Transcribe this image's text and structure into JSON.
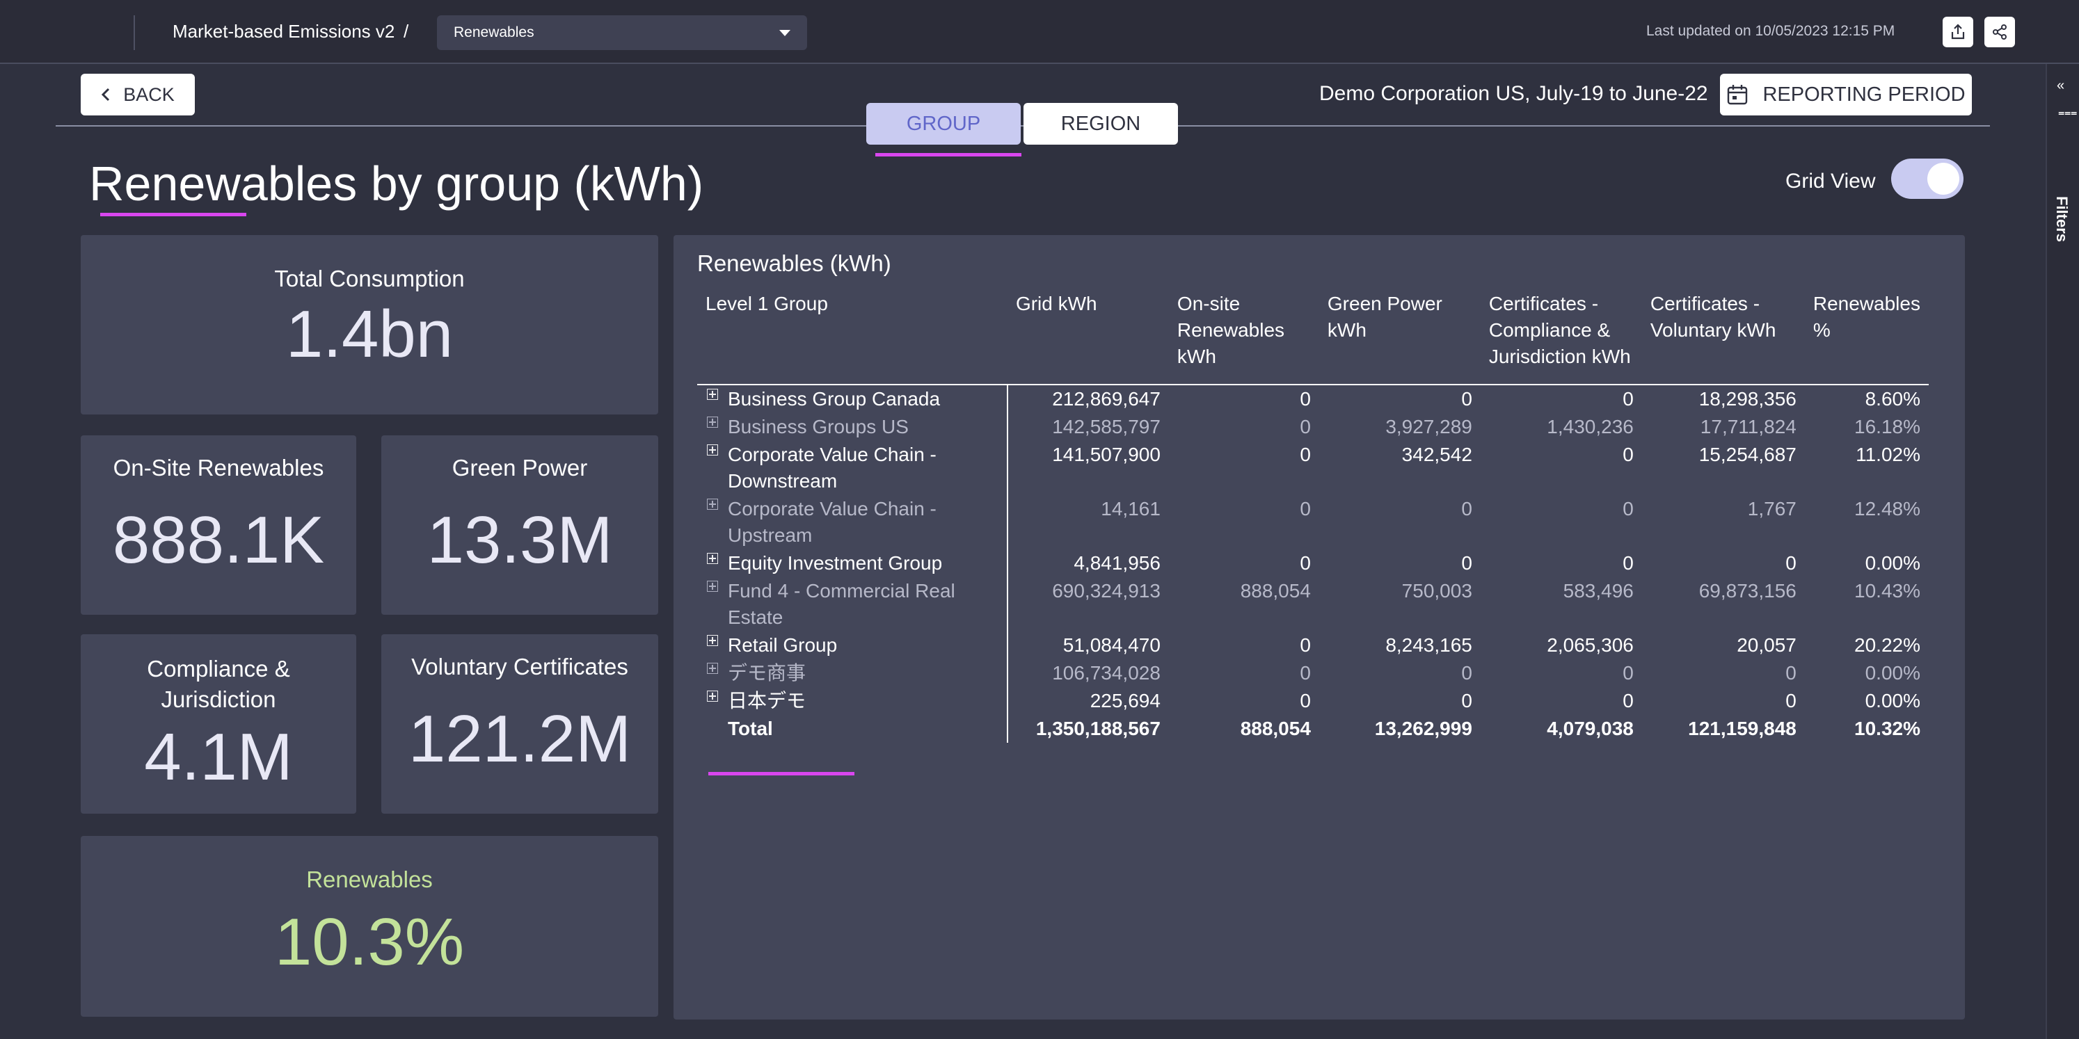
{
  "header": {
    "breadcrumb_title": "Market-based Emissions v2",
    "breadcrumb_sep": "/",
    "report_select": "Renewables",
    "last_updated": "Last updated on 10/05/2023 12:15 PM"
  },
  "nav": {
    "back_label": "BACK",
    "tabs": [
      {
        "label": "GROUP",
        "active": true
      },
      {
        "label": "REGION",
        "active": false
      }
    ],
    "company_period": "Demo Corporation US, July-19 to June-22",
    "reporting_period_label": "REPORTING PERIOD"
  },
  "filters_rail": {
    "label": "Filters"
  },
  "page": {
    "title": "Renewables by group (kWh)",
    "grid_view_label": "Grid View",
    "grid_view_on": true
  },
  "kpis": {
    "total": {
      "label": "Total Consumption",
      "value": "1.4bn"
    },
    "onsite": {
      "label": "On-Site Renewables",
      "value": "888.1K"
    },
    "green": {
      "label": "Green Power",
      "value": "13.3M"
    },
    "compliance": {
      "label": "Compliance & Jurisdiction",
      "value": "4.1M"
    },
    "voluntary": {
      "label": "Voluntary Certificates",
      "value": "121.2M"
    },
    "renewables": {
      "label": "Renewables",
      "value": "10.3%",
      "accent": "#c3e29a"
    }
  },
  "table": {
    "title": "Renewables (kWh)",
    "headers": [
      "Level 1 Group",
      "Grid kWh",
      "On-site Renewables kWh",
      "Green Power kWh",
      "Certificates - Compliance & Jurisdiction kWh",
      "Certificates - Voluntary kWh",
      "Renewables %"
    ],
    "rows": [
      {
        "name": "Business Group Canada",
        "grid": "212,869,647",
        "onsite": "0",
        "green": "0",
        "compliance": "0",
        "voluntary": "18,298,356",
        "pct": "8.60%",
        "style": "bright"
      },
      {
        "name": "Business Groups US",
        "grid": "142,585,797",
        "onsite": "0",
        "green": "3,927,289",
        "compliance": "1,430,236",
        "voluntary": "17,711,824",
        "pct": "16.18%",
        "style": "dim"
      },
      {
        "name": "Corporate Value Chain - Downstream",
        "grid": "141,507,900",
        "onsite": "0",
        "green": "342,542",
        "compliance": "0",
        "voluntary": "15,254,687",
        "pct": "11.02%",
        "style": "bright"
      },
      {
        "name": "Corporate Value Chain - Upstream",
        "grid": "14,161",
        "onsite": "0",
        "green": "0",
        "compliance": "0",
        "voluntary": "1,767",
        "pct": "12.48%",
        "style": "dim"
      },
      {
        "name": "Equity Investment Group",
        "grid": "4,841,956",
        "onsite": "0",
        "green": "0",
        "compliance": "0",
        "voluntary": "0",
        "pct": "0.00%",
        "style": "bright"
      },
      {
        "name": "Fund 4 - Commercial Real Estate",
        "grid": "690,324,913",
        "onsite": "888,054",
        "green": "750,003",
        "compliance": "583,496",
        "voluntary": "69,873,156",
        "pct": "10.43%",
        "style": "dim"
      },
      {
        "name": "Retail Group",
        "grid": "51,084,470",
        "onsite": "0",
        "green": "8,243,165",
        "compliance": "2,065,306",
        "voluntary": "20,057",
        "pct": "20.22%",
        "style": "bright"
      },
      {
        "name": "デモ商事",
        "grid": "106,734,028",
        "onsite": "0",
        "green": "0",
        "compliance": "0",
        "voluntary": "0",
        "pct": "0.00%",
        "style": "dim"
      },
      {
        "name": "日本デモ",
        "grid": "225,694",
        "onsite": "0",
        "green": "0",
        "compliance": "0",
        "voluntary": "0",
        "pct": "0.00%",
        "style": "bright"
      }
    ],
    "total": {
      "name": "Total",
      "grid": "1,350,188,567",
      "onsite": "888,054",
      "green": "13,262,999",
      "compliance": "4,079,038",
      "voluntary": "121,159,848",
      "pct": "10.32%"
    }
  }
}
